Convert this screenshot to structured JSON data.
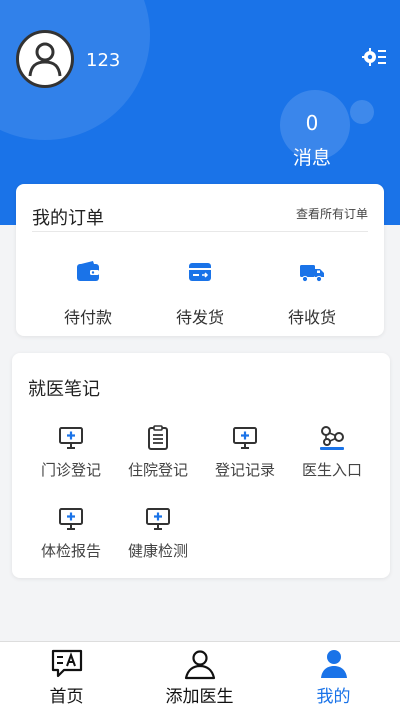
{
  "profile": {
    "username": "123"
  },
  "header": {
    "message_count": "0",
    "message_label": "消息"
  },
  "orders": {
    "title": "我的订单",
    "view_all": "查看所有订单",
    "items": [
      {
        "label": "待付款",
        "icon": "wallet-icon"
      },
      {
        "label": "待发货",
        "icon": "card-icon"
      },
      {
        "label": "待收货",
        "icon": "truck-icon"
      }
    ]
  },
  "notes": {
    "title": "就医笔记",
    "items": [
      {
        "label": "门诊登记",
        "icon": "monitor-plus-icon"
      },
      {
        "label": "住院登记",
        "icon": "clipboard-icon"
      },
      {
        "label": "登记记录",
        "icon": "monitor-plus-icon"
      },
      {
        "label": "医生入口",
        "icon": "molecule-icon"
      },
      {
        "label": "体检报告",
        "icon": "monitor-plus-icon"
      },
      {
        "label": "健康检测",
        "icon": "monitor-plus-icon"
      }
    ]
  },
  "tabbar": {
    "items": [
      {
        "label": "首页",
        "icon": "translate-icon"
      },
      {
        "label": "添加医生",
        "icon": "person-outline-icon"
      },
      {
        "label": "我的",
        "icon": "person-filled-icon"
      }
    ],
    "active": "我的"
  },
  "colors": {
    "primary": "#1a73e8",
    "background": "#f3f4f6"
  }
}
